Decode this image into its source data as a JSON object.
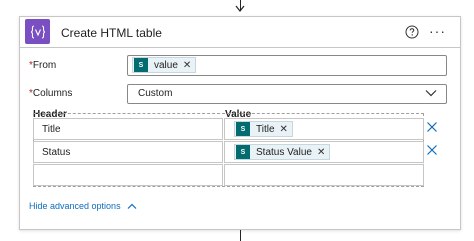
{
  "action": {
    "title": "Create HTML table",
    "icon": "curly-brace-variable-icon",
    "accent_color": "#7a4fc2"
  },
  "from_field": {
    "label": "From",
    "required_marker": "*",
    "token": {
      "label": "value",
      "icon": "sharepoint-icon",
      "icon_text": "S"
    }
  },
  "columns_field": {
    "label": "Columns",
    "required_marker": "*",
    "selected": "Custom"
  },
  "table": {
    "header_label": "Header",
    "value_label": "Value",
    "rows": [
      {
        "header": "Title",
        "token": {
          "label": "Title",
          "icon_text": "S"
        }
      },
      {
        "header": "Status",
        "token": {
          "label": "Status Value",
          "icon_text": "S"
        }
      }
    ]
  },
  "advanced": {
    "label": "Hide advanced options"
  }
}
